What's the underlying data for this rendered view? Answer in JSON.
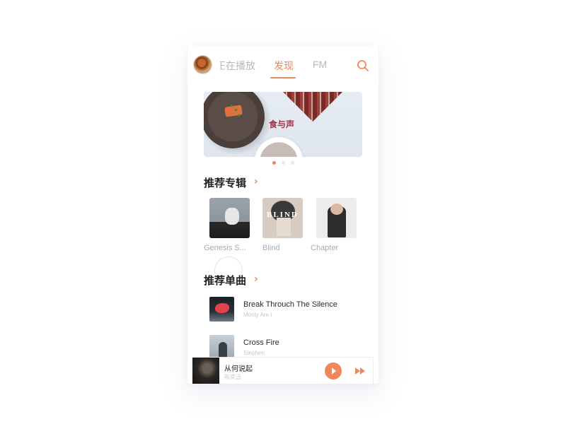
{
  "header": {
    "avatar": "user-avatar",
    "tabs": [
      {
        "label": "正在播放",
        "active": false
      },
      {
        "label": "发现",
        "active": true
      },
      {
        "label": "FM",
        "active": false
      }
    ],
    "search_icon": "search-icon"
  },
  "banner": {
    "title": "食与声",
    "page_count": 3,
    "active_page": 1
  },
  "albums_section": {
    "title": "推荐专辑",
    "albums": [
      {
        "name": "Genesis S..."
      },
      {
        "name": "Blind",
        "cover_text": "BLIND"
      },
      {
        "name": "Chapter"
      }
    ]
  },
  "songs_section": {
    "title": "推荐单曲",
    "songs": [
      {
        "title": "Break Throuch The Silence",
        "artist": "Monty Are I"
      },
      {
        "title": "Cross Fire",
        "artist": "Stephen"
      }
    ]
  },
  "player": {
    "title": "从何说起",
    "artist": "陈奕迅",
    "play_icon": "play-icon",
    "next_icon": "fast-forward-icon"
  },
  "colors": {
    "accent": "#f0875a",
    "banner_title": "#b22a4a",
    "inactive_text": "#b5b8bf"
  }
}
